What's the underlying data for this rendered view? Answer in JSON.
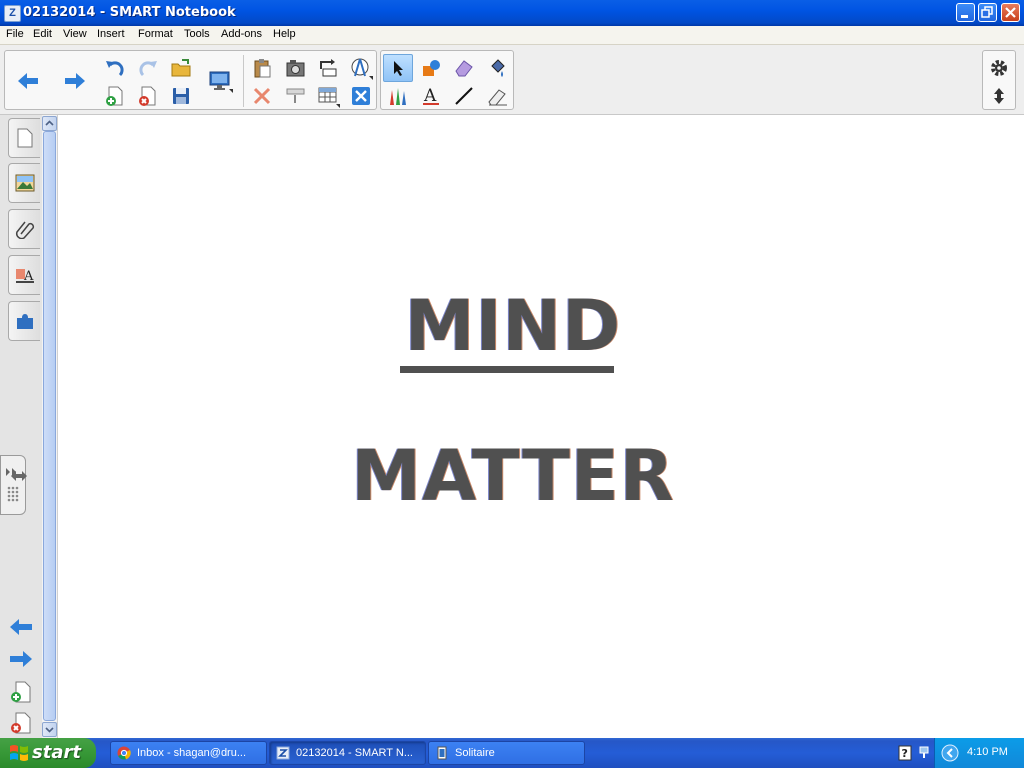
{
  "window": {
    "title": "02132014 - SMART Notebook",
    "icon_glyph": "Z"
  },
  "menu": [
    "File",
    "Edit",
    "View",
    "Insert",
    "Format",
    "Tools",
    "Add-ons",
    "Help"
  ],
  "canvas": {
    "word1": "MIND",
    "word2": "MATTER",
    "text_color": "#505050"
  },
  "taskbar": {
    "start_label": "start",
    "tasks": [
      {
        "label": "Inbox - shagan@dru...",
        "icon": "chrome-icon"
      },
      {
        "label": "02132014 - SMART N...",
        "icon": "smart-notebook-icon"
      },
      {
        "label": "Solitaire",
        "icon": "solitaire-icon"
      }
    ],
    "clock": "4:10 PM"
  },
  "colors": {
    "titlebar": "#0054e3",
    "taskbar": "#245dd7",
    "start": "#379837",
    "accent_blue": "#2f6fe4"
  }
}
